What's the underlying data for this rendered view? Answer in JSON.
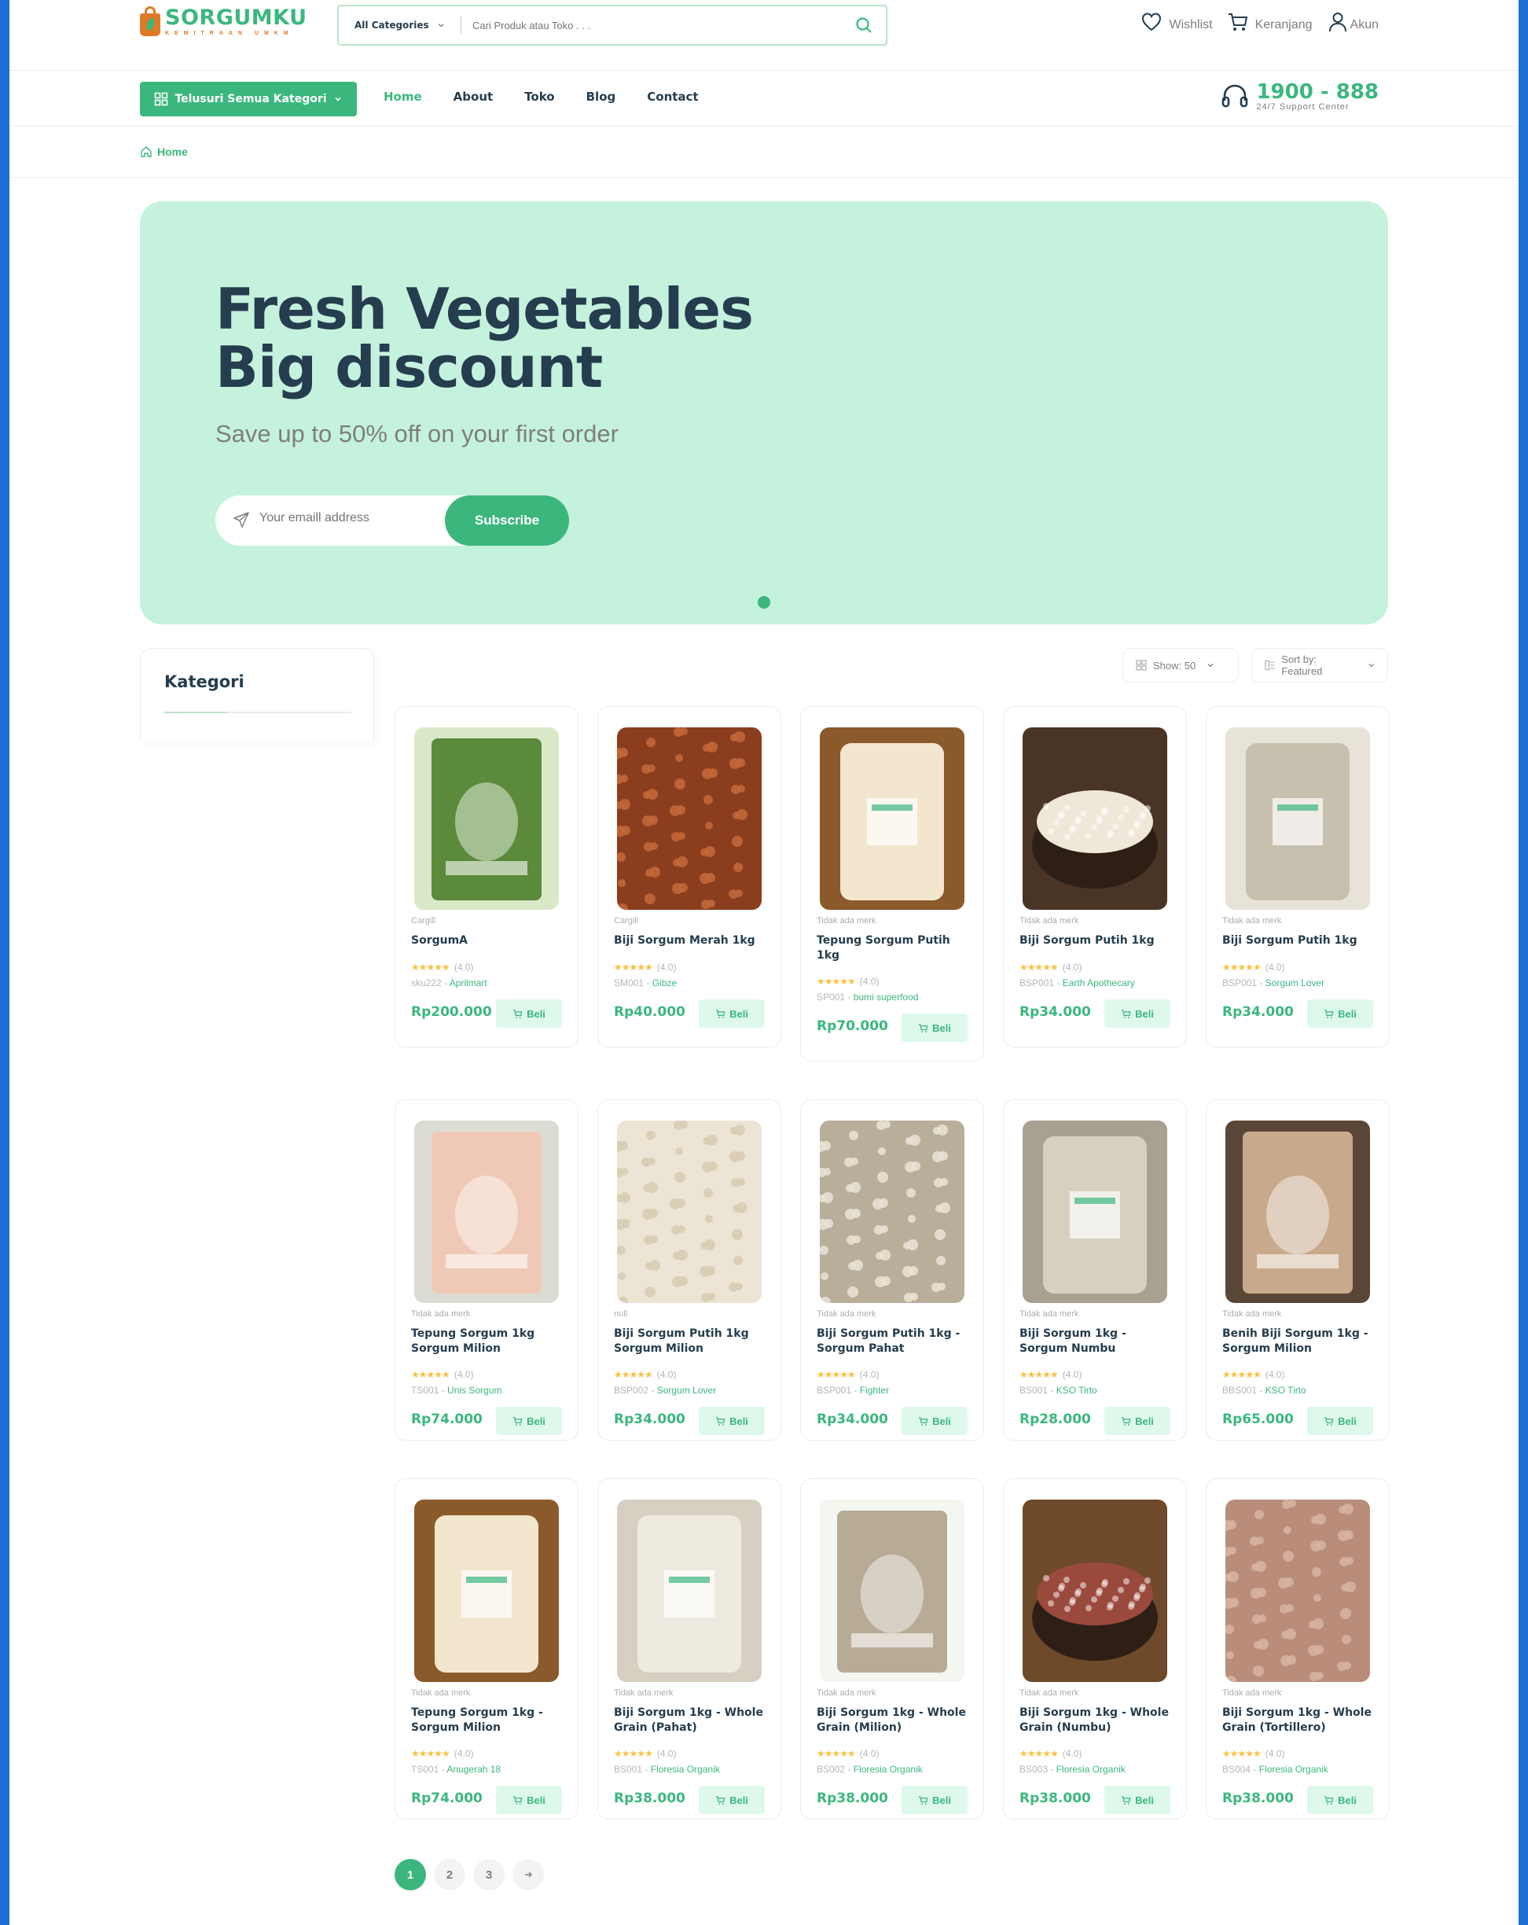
{
  "header": {
    "logo_name": "SORGUMKU",
    "logo_tagline": "KEMITRAAN UMKM",
    "search_category": "All Categories",
    "search_placeholder": "Cari Produk atau Toko . . .",
    "wishlist": "Wishlist",
    "cart": "Keranjang",
    "account": "Akun"
  },
  "nav": {
    "browse": "Telusuri Semua Kategori",
    "menu": [
      "Home",
      "About",
      "Toko",
      "Blog",
      "Contact"
    ],
    "support_number": "1900 - 888",
    "support_label": "24/7 Support Center"
  },
  "breadcrumb": {
    "home": "Home"
  },
  "hero": {
    "title_line1": "Fresh Vegetables",
    "title_line2": "Big discount",
    "subtitle": "Save up to 50% off on your first order",
    "email_placeholder": "Your emaill address",
    "subscribe": "Subscribe"
  },
  "sidebar": {
    "title": "Kategori"
  },
  "toolbar": {
    "show": "Show: 50",
    "sort": "Sort by: Featured"
  },
  "buy_label": "Beli",
  "products": [
    {
      "brand": "Cargill",
      "name": "SorgumA",
      "rating": "(4.0)",
      "sku": "sku222",
      "vendor": "Aprilmart",
      "price": "Rp200.000"
    },
    {
      "brand": "Cargill",
      "name": "Biji Sorgum Merah 1kg",
      "rating": "(4.0)",
      "sku": "SM001",
      "vendor": "Gibze",
      "price": "Rp40.000"
    },
    {
      "brand": "Tidak ada merk",
      "name": "Tepung Sorgum Putih 1kg",
      "rating": "(4.0)",
      "sku": "SP001",
      "vendor": "bumi superfood",
      "price": "Rp70.000"
    },
    {
      "brand": "Tidak ada merk",
      "name": "Biji Sorgum Putih 1kg",
      "rating": "(4.0)",
      "sku": "BSP001",
      "vendor": "Earth Apothecary",
      "price": "Rp34.000"
    },
    {
      "brand": "Tidak ada merk",
      "name": "Biji Sorgum Putih 1kg",
      "rating": "(4.0)",
      "sku": "BSP001",
      "vendor": "Sorgum Lover",
      "price": "Rp34.000"
    },
    {
      "brand": "Tidak ada merk",
      "name": "Tepung Sorgum 1kg Sorgum Milion",
      "rating": "(4.0)",
      "sku": "TS001",
      "vendor": "Unis Sorgum",
      "price": "Rp74.000"
    },
    {
      "brand": "null",
      "name": "Biji Sorgum Putih 1kg Sorgum Milion",
      "rating": "(4.0)",
      "sku": "BSP002",
      "vendor": "Sorgum Lover",
      "price": "Rp34.000"
    },
    {
      "brand": "Tidak ada merk",
      "name": "Biji Sorgum Putih 1kg - Sorgum Pahat",
      "rating": "(4.0)",
      "sku": "BSP001",
      "vendor": "Fighter",
      "price": "Rp34.000"
    },
    {
      "brand": "Tidak ada merk",
      "name": "Biji Sorgum 1kg - Sorgum Numbu",
      "rating": "(4.0)",
      "sku": "BS001",
      "vendor": "KSO Tirto",
      "price": "Rp28.000"
    },
    {
      "brand": "Tidak ada merk",
      "name": "Benih Biji Sorgum 1kg - Sorgum Milion",
      "rating": "(4.0)",
      "sku": "BBS001",
      "vendor": "KSO Tirto",
      "price": "Rp65.000"
    },
    {
      "brand": "Tidak ada merk",
      "name": "Tepung Sorgum 1kg - Sorgum Milion",
      "rating": "(4.0)",
      "sku": "TS001",
      "vendor": "Anugerah 18",
      "price": "Rp74.000"
    },
    {
      "brand": "Tidak ada merk",
      "name": "Biji Sorgum 1kg - Whole Grain (Pahat)",
      "rating": "(4.0)",
      "sku": "BS001",
      "vendor": "Floresia Organik",
      "price": "Rp38.000"
    },
    {
      "brand": "Tidak ada merk",
      "name": "Biji Sorgum 1kg - Whole Grain (Milion)",
      "rating": "(4.0)",
      "sku": "BS002",
      "vendor": "Floresia Organik",
      "price": "Rp38.000"
    },
    {
      "brand": "Tidak ada merk",
      "name": "Biji Sorgum 1kg - Whole Grain (Numbu)",
      "rating": "(4.0)",
      "sku": "BS003",
      "vendor": "Floresia Organik",
      "price": "Rp38.000"
    },
    {
      "brand": "Tidak ada merk",
      "name": "Biji Sorgum 1kg - Whole Grain (Tortillero)",
      "rating": "(4.0)",
      "sku": "BS004",
      "vendor": "Floresia Organik",
      "price": "Rp38.000"
    }
  ],
  "pagination": [
    "1",
    "2",
    "3"
  ],
  "colors": {
    "brand": "#3bb77e",
    "hero_bg": "#c5f2dd",
    "text": "#253d4e",
    "accent": "#e07a26"
  }
}
